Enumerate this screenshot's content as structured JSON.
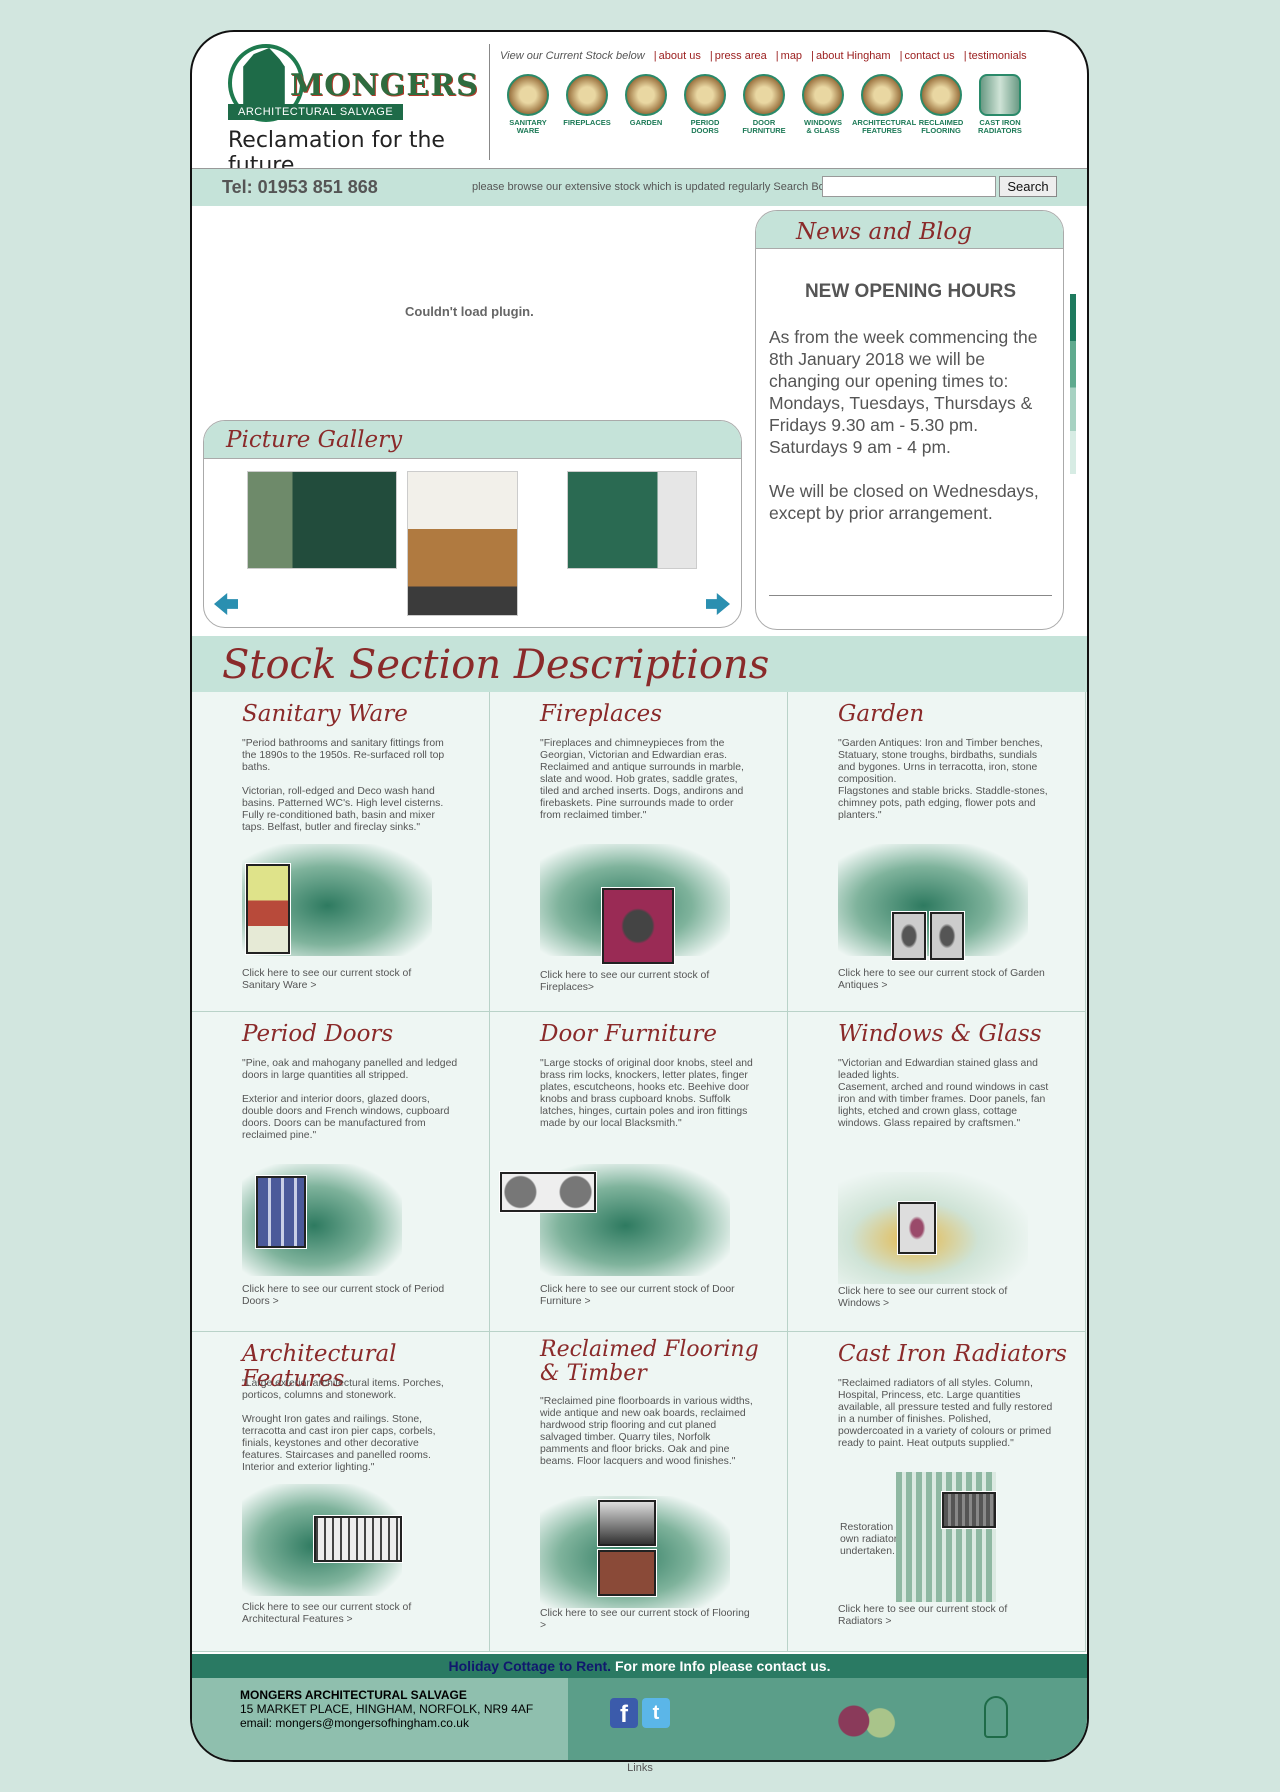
{
  "header": {
    "logo_name": "MONGERS",
    "logo_sub": "ARCHITECTURAL SALVAGE",
    "tagline": "Reclamation for the future...",
    "nav_intro": "View our Current Stock below",
    "nav": [
      "about us",
      "press area",
      "map",
      "about Hingham",
      "contact us",
      "testimonials"
    ],
    "categories": [
      {
        "l1": "SANITARY",
        "l2": "WARE"
      },
      {
        "l1": "FIREPLACES",
        "l2": ""
      },
      {
        "l1": "GARDEN",
        "l2": ""
      },
      {
        "l1": "PERIOD",
        "l2": "DOORS"
      },
      {
        "l1": "DOOR",
        "l2": "FURNITURE"
      },
      {
        "l1": "WINDOWS",
        "l2": "& GLASS"
      },
      {
        "l1": "ARCHITECTURAL",
        "l2": "FEATURES"
      },
      {
        "l1": "RECLAIMED",
        "l2": "FLOORING"
      },
      {
        "l1": "CAST IRON",
        "l2": "RADIATORS"
      }
    ]
  },
  "telbar": {
    "tel": "Tel: 01953 851 868",
    "browse": "please browse our extensive stock which is updated regularly Search Box",
    "search_placeholder": "",
    "search_button": "Search"
  },
  "plugin": "Couldn't load plugin.",
  "gallery": {
    "title": "Picture Gallery"
  },
  "news": {
    "title": "News and Blog",
    "headline": "NEW OPENING HOURS",
    "p1": "As from the week commencing the 8th January 2018 we will be changing our opening times to: Mondays, Tuesdays, Thursdays & Fridays 9.30 am - 5.30 pm. Saturdays 9 am - 4 pm.",
    "p2": "We will be closed on Wednesdays, except by prior arrangement."
  },
  "stock": {
    "title": "Stock Section Descriptions",
    "sections": [
      {
        "title": "Sanitary Ware",
        "d1": "\"Period bathrooms and sanitary fittings from the 1890s to the 1950s. Re-surfaced roll top baths.",
        "d2": "Victorian, roll-edged and Deco wash hand basins. Patterned WC's. High level cisterns. Fully re-conditioned bath, basin and mixer taps. Belfast, butler and fireclay sinks.\"",
        "link": "Click here to see our current stock of Sanitary Ware >"
      },
      {
        "title": "Fireplaces",
        "d1": "\"Fireplaces and chimneypieces from the Georgian, Victorian and Edwardian eras. Reclaimed and antique surrounds in marble, slate and wood. Hob grates, saddle grates, tiled and arched inserts. Dogs, andirons and firebaskets. Pine surrounds made to order from reclaimed timber.\"",
        "d2": "",
        "link": "Click here to see our current stock of Fireplaces>"
      },
      {
        "title": "Garden",
        "d1": "\"Garden Antiques: Iron and Timber benches, Statuary, stone troughs, birdbaths, sundials and bygones. Urns in terracotta, iron, stone composition.",
        "d2": "Flagstones and stable bricks. Staddle-stones, chimney pots, path edging, flower pots and planters.\"",
        "link": "Click here to see our current stock of Garden Antiques >"
      },
      {
        "title": "Period Doors",
        "d1": "\"Pine, oak and mahogany panelled and ledged doors in large quantities all stripped.",
        "d2": "Exterior and interior doors, glazed doors, double doors and French windows, cupboard doors. Doors can be manufactured from reclaimed pine.\"",
        "link": "Click here to see our current stock of Period Doors >"
      },
      {
        "title": "Door Furniture",
        "d1": "\"Large stocks of original door knobs, steel and brass rim locks, knockers, letter plates, finger plates, escutcheons, hooks etc. Beehive door knobs and brass cupboard knobs. Suffolk latches, hinges, curtain poles and iron fittings made by our local Blacksmith.\"",
        "d2": "",
        "link": "Click here to see our current stock of Door Furniture >"
      },
      {
        "title": "Windows & Glass",
        "d1": "\"Victorian and Edwardian stained glass and leaded lights.",
        "d2": "Casement, arched and round windows in cast iron and with timber frames. Door panels, fan lights, etched and crown glass, cottage windows. Glass repaired by craftsmen.\"",
        "link": "Click here to see our current stock of Windows >"
      },
      {
        "title": "Architectural Features",
        "d1": "\"Large exterior architectural items. Porches, porticos, columns and stonework.",
        "d2": "Wrought Iron gates and railings. Stone, terracotta and cast iron pier caps, corbels, finials, keystones and other decorative features. Staircases and panelled rooms. Interior and exterior lighting.\"",
        "link": "Click here to see our current stock of Architectural Features >"
      },
      {
        "title": "Reclaimed Flooring & Timber",
        "d1": "\"Reclaimed pine floorboards in various widths, wide antique and new oak boards, reclaimed hardwood strip flooring and cut planed salvaged timber. Quarry tiles, Norfolk pamments and floor bricks. Oak and pine beams. Floor lacquers and wood finishes.\"",
        "d2": "",
        "link": "Click here to see our current stock of Flooring >"
      },
      {
        "title": "Cast Iron Radiators",
        "d1": "\"Reclaimed radiators of all styles. Column, Hospital, Princess, etc. Large quantities available, all pressure tested and fully restored in a number of finishes. Polished, powdercoated in a variety of colours or primed ready to paint. Heat outputs supplied.\"",
        "d2": "",
        "extra": "Restoration of your own radiators undertaken.",
        "link": "Click here to see our current stock of Radiators >"
      }
    ]
  },
  "footer": {
    "holiday_a": "Holiday Cottage to Rent.",
    "holiday_b": " For more Info please contact us.",
    "company": "MONGERS ARCHITECTURAL SALVAGE",
    "address": "15 MARKET PLACE, HINGHAM, NORFOLK, NR9 4AF",
    "email": "email: mongers@mongersofhingham.co.uk",
    "fb": "f",
    "tw": "t",
    "links": "Links"
  },
  "colors": {
    "accent": "#2a7a63",
    "band": "#c5e3d9",
    "link": "#9a1c1c",
    "script": "#8a2a2a"
  }
}
